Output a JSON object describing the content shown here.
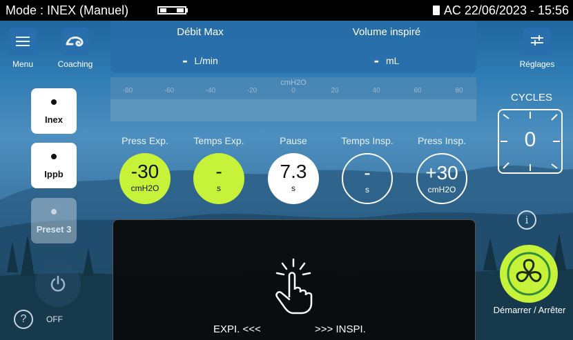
{
  "status_bar": {
    "mode": "Mode : INEX (Manuel)",
    "power_datetime": "AC 22/06/2023 - 15:56"
  },
  "nav": {
    "menu_label": "Menu",
    "coaching_label": "Coaching",
    "settings_label": "Réglages"
  },
  "measures": {
    "peak_flow": {
      "title": "Débit Max",
      "value": "-",
      "unit": "L/min"
    },
    "inspired_volume": {
      "title": "Volume inspiré",
      "value": "-",
      "unit": "mL"
    }
  },
  "pressure_scale": {
    "unit": "cmH2O",
    "ticks": [
      "-80",
      "-60",
      "-40",
      "-20",
      "0",
      "20",
      "40",
      "60",
      "80"
    ]
  },
  "parameters": [
    {
      "label": "Press Exp.",
      "value": "-30",
      "unit": "cmH2O",
      "style": "green"
    },
    {
      "label": "Temps Exp.",
      "value": "-",
      "unit": "s",
      "style": "green"
    },
    {
      "label": "Pause",
      "value": "7.3",
      "unit": "s",
      "style": "white"
    },
    {
      "label": "Temps Insp.",
      "value": "-",
      "unit": "s",
      "style": "outline"
    },
    {
      "label": "Press Insp.",
      "value": "+30",
      "unit": "cmH2O",
      "style": "outline"
    }
  ],
  "mode_tiles": [
    {
      "label": "Inex",
      "enabled": true
    },
    {
      "label": "Ippb",
      "enabled": true
    },
    {
      "label": "Preset 3",
      "enabled": false
    }
  ],
  "power": {
    "off_label": "OFF",
    "help_icon": "question-circle-icon"
  },
  "cycles": {
    "label": "CYCLES",
    "value": "0"
  },
  "start_stop": {
    "label": "Démarrer / Arrêter",
    "icon": "fan-icon"
  },
  "trigger_panel": {
    "expi_label": "EXPI. <<<",
    "inspi_label": ">>> INSPI.",
    "icon": "touch-hand-icon"
  },
  "colors": {
    "accent_green": "#c7f23a",
    "tile_blue": "#2a6fae",
    "status_bar": "#000000"
  }
}
